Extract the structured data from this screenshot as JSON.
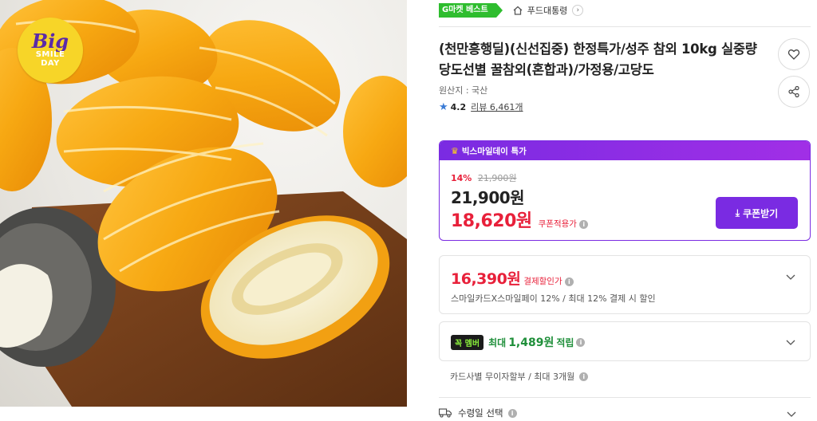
{
  "badge": {
    "big": "Big",
    "line1": "SMILE",
    "line2": "DAY"
  },
  "header": {
    "gmarket_badge": "G마켓 베스트",
    "store_name": "푸드대통령"
  },
  "product": {
    "title": "(천만흥행딜)(신선집중) 한정특가/성주 참외 10kg 실중량 당도선별 꿀참외(혼합과)/가정용/고당도",
    "origin": "원산지 : 국산",
    "rating": "4.2",
    "review_label": "리뷰 6,461개"
  },
  "promotion": {
    "header": "빅스마일데이 특가",
    "discount_rate": "14%",
    "original_price": "21,900원",
    "sale_price": "21,900원",
    "coupon_price": "18,620원",
    "coupon_price_label": "쿠폰적용가",
    "coupon_button": "쿠폰받기"
  },
  "payment": {
    "price": "16,390원",
    "label": "결제할인가",
    "description": "스마일카드X스마일페이 12% / 최대 12% 결제 시 할인"
  },
  "membership": {
    "logo": "꼭 멤버",
    "prefix": "최대",
    "amount": "1,489원",
    "suffix": "적립"
  },
  "installment": "카드사별 무이자할부 / 최대 3개월",
  "delivery": {
    "label": "수령일 선택"
  },
  "colors": {
    "accent_purple": "#7a2be2",
    "price_red": "#e8203a",
    "gmarket_green": "#2ebd2e",
    "member_green": "#1f8f3a",
    "badge_yellow": "#f7d528"
  },
  "icons": {
    "wishlist": "heart-icon",
    "share": "share-icon",
    "store": "home-icon",
    "rating": "star-icon",
    "delivery": "truck-icon",
    "expand": "chevron-down-icon",
    "coupon": "download-icon",
    "promo": "crown-icon"
  }
}
